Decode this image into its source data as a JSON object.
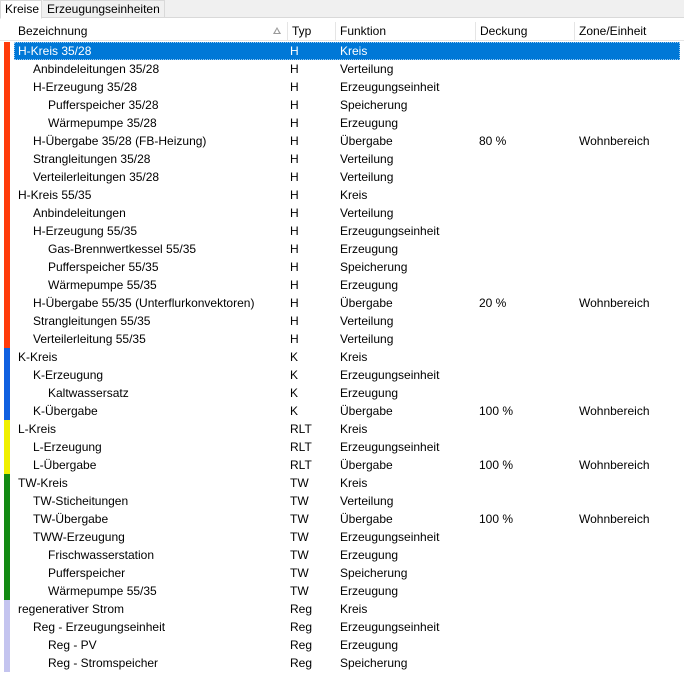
{
  "tabs": [
    "Kreise",
    "Erzeugungseinheiten"
  ],
  "columns": [
    "Bezeichnung",
    "Typ",
    "Funktion",
    "Deckung",
    "Zone/Einheit"
  ],
  "colors": {
    "heating": "#ff3b0a",
    "cooling": "#1060e0",
    "ventilation": "#f0f000",
    "hotwater": "#138a13",
    "renewable": "#c4c4ef",
    "selection": "#0078d7"
  },
  "rows": [
    {
      "name": "H-Kreis 35/28",
      "indent": 0,
      "typ": "H",
      "funktion": "Kreis",
      "deckung": "",
      "zone": "",
      "group": "heating",
      "selected": true
    },
    {
      "name": "Anbindeleitungen 35/28",
      "indent": 1,
      "typ": "H",
      "funktion": "Verteilung",
      "deckung": "",
      "zone": "",
      "group": "heating"
    },
    {
      "name": "H-Erzeugung 35/28",
      "indent": 1,
      "typ": "H",
      "funktion": "Erzeugungseinheit",
      "deckung": "",
      "zone": "",
      "group": "heating"
    },
    {
      "name": "Pufferspeicher 35/28",
      "indent": 2,
      "typ": "H",
      "funktion": "Speicherung",
      "deckung": "",
      "zone": "",
      "group": "heating"
    },
    {
      "name": "Wärmepumpe 35/28",
      "indent": 2,
      "typ": "H",
      "funktion": "Erzeugung",
      "deckung": "",
      "zone": "",
      "group": "heating"
    },
    {
      "name": "H-Übergabe 35/28 (FB-Heizung)",
      "indent": 1,
      "typ": "H",
      "funktion": "Übergabe",
      "deckung": "80 %",
      "zone": "Wohnbereich",
      "group": "heating"
    },
    {
      "name": "Strangleitungen 35/28",
      "indent": 1,
      "typ": "H",
      "funktion": "Verteilung",
      "deckung": "",
      "zone": "",
      "group": "heating"
    },
    {
      "name": "Verteilerleitungen 35/28",
      "indent": 1,
      "typ": "H",
      "funktion": "Verteilung",
      "deckung": "",
      "zone": "",
      "group": "heating"
    },
    {
      "name": "H-Kreis 55/35",
      "indent": 0,
      "typ": "H",
      "funktion": "Kreis",
      "deckung": "",
      "zone": "",
      "group": "heating"
    },
    {
      "name": "Anbindeleitungen",
      "indent": 1,
      "typ": "H",
      "funktion": "Verteilung",
      "deckung": "",
      "zone": "",
      "group": "heating"
    },
    {
      "name": "H-Erzeugung 55/35",
      "indent": 1,
      "typ": "H",
      "funktion": "Erzeugungseinheit",
      "deckung": "",
      "zone": "",
      "group": "heating"
    },
    {
      "name": "Gas-Brennwertkessel 55/35",
      "indent": 2,
      "typ": "H",
      "funktion": "Erzeugung",
      "deckung": "",
      "zone": "",
      "group": "heating"
    },
    {
      "name": "Pufferspeicher 55/35",
      "indent": 2,
      "typ": "H",
      "funktion": "Speicherung",
      "deckung": "",
      "zone": "",
      "group": "heating"
    },
    {
      "name": "Wärmepumpe 55/35",
      "indent": 2,
      "typ": "H",
      "funktion": "Erzeugung",
      "deckung": "",
      "zone": "",
      "group": "heating"
    },
    {
      "name": "H-Übergabe 55/35 (Unterflurkonvektoren)",
      "indent": 1,
      "typ": "H",
      "funktion": "Übergabe",
      "deckung": "20 %",
      "zone": "Wohnbereich",
      "group": "heating"
    },
    {
      "name": "Strangleitungen 55/35",
      "indent": 1,
      "typ": "H",
      "funktion": "Verteilung",
      "deckung": "",
      "zone": "",
      "group": "heating"
    },
    {
      "name": "Verteilerleitung 55/35",
      "indent": 1,
      "typ": "H",
      "funktion": "Verteilung",
      "deckung": "",
      "zone": "",
      "group": "heating"
    },
    {
      "name": "K-Kreis",
      "indent": 0,
      "typ": "K",
      "funktion": "Kreis",
      "deckung": "",
      "zone": "",
      "group": "cooling"
    },
    {
      "name": "K-Erzeugung",
      "indent": 1,
      "typ": "K",
      "funktion": "Erzeugungseinheit",
      "deckung": "",
      "zone": "",
      "group": "cooling"
    },
    {
      "name": "Kaltwassersatz",
      "indent": 2,
      "typ": "K",
      "funktion": "Erzeugung",
      "deckung": "",
      "zone": "",
      "group": "cooling"
    },
    {
      "name": "K-Übergabe",
      "indent": 1,
      "typ": "K",
      "funktion": "Übergabe",
      "deckung": "100 %",
      "zone": "Wohnbereich",
      "group": "cooling"
    },
    {
      "name": "L-Kreis",
      "indent": 0,
      "typ": "RLT",
      "funktion": "Kreis",
      "deckung": "",
      "zone": "",
      "group": "ventilation"
    },
    {
      "name": "L-Erzeugung",
      "indent": 1,
      "typ": "RLT",
      "funktion": "Erzeugungseinheit",
      "deckung": "",
      "zone": "",
      "group": "ventilation"
    },
    {
      "name": "L-Übergabe",
      "indent": 1,
      "typ": "RLT",
      "funktion": "Übergabe",
      "deckung": "100 %",
      "zone": "Wohnbereich",
      "group": "ventilation"
    },
    {
      "name": "TW-Kreis",
      "indent": 0,
      "typ": "TW",
      "funktion": "Kreis",
      "deckung": "",
      "zone": "",
      "group": "hotwater"
    },
    {
      "name": "TW-Sticheitungen",
      "indent": 1,
      "typ": "TW",
      "funktion": "Verteilung",
      "deckung": "",
      "zone": "",
      "group": "hotwater"
    },
    {
      "name": "TW-Übergabe",
      "indent": 1,
      "typ": "TW",
      "funktion": "Übergabe",
      "deckung": "100 %",
      "zone": "Wohnbereich",
      "group": "hotwater"
    },
    {
      "name": "TWW-Erzeugung",
      "indent": 1,
      "typ": "TW",
      "funktion": "Erzeugungseinheit",
      "deckung": "",
      "zone": "",
      "group": "hotwater"
    },
    {
      "name": "Frischwasserstation",
      "indent": 2,
      "typ": "TW",
      "funktion": "Erzeugung",
      "deckung": "",
      "zone": "",
      "group": "hotwater"
    },
    {
      "name": "Pufferspeicher",
      "indent": 2,
      "typ": "TW",
      "funktion": "Speicherung",
      "deckung": "",
      "zone": "",
      "group": "hotwater"
    },
    {
      "name": "Wärmepumpe 55/35",
      "indent": 2,
      "typ": "TW",
      "funktion": "Erzeugung",
      "deckung": "",
      "zone": "",
      "group": "hotwater"
    },
    {
      "name": "regenerativer Strom",
      "indent": 0,
      "typ": "Reg",
      "funktion": "Kreis",
      "deckung": "",
      "zone": "",
      "group": "renewable"
    },
    {
      "name": "Reg - Erzeugungseinheit",
      "indent": 1,
      "typ": "Reg",
      "funktion": "Erzeugungseinheit",
      "deckung": "",
      "zone": "",
      "group": "renewable"
    },
    {
      "name": "Reg - PV",
      "indent": 2,
      "typ": "Reg",
      "funktion": "Erzeugung",
      "deckung": "",
      "zone": "",
      "group": "renewable"
    },
    {
      "name": "Reg - Stromspeicher",
      "indent": 2,
      "typ": "Reg",
      "funktion": "Speicherung",
      "deckung": "",
      "zone": "",
      "group": "renewable"
    }
  ]
}
